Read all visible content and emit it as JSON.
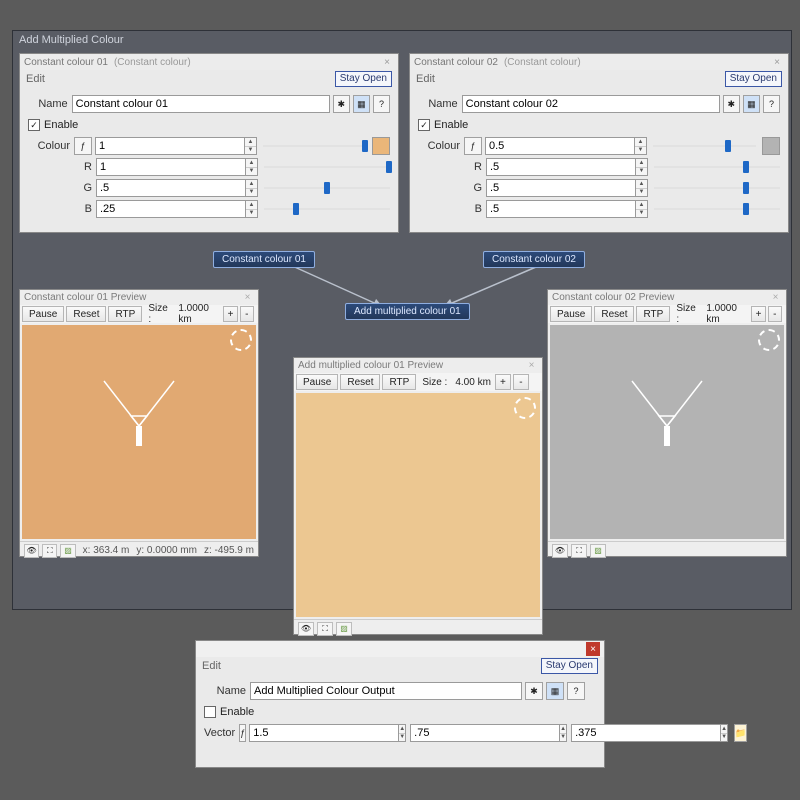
{
  "mainTitle": "Add Multiplied Colour",
  "stayOpen": "Stay Open",
  "editLabel": "Edit",
  "nameLabel": "Name",
  "enableLabel": "Enable",
  "colourLabel": "Colour",
  "vectorLabel": "Vector",
  "panels": {
    "c1": {
      "title": "Constant colour 01",
      "type": "(Constant colour)",
      "name": "Constant colour 01",
      "enabled": true,
      "channels": {
        "master": {
          "label": "",
          "value": "1",
          "pos": 0.99
        },
        "r": {
          "label": "R",
          "value": "1",
          "pos": 0.99
        },
        "g": {
          "label": "G",
          "value": ".5",
          "pos": 0.5
        },
        "b": {
          "label": "B",
          "value": ".25",
          "pos": 0.25
        }
      },
      "swatch": "#eab679"
    },
    "c2": {
      "title": "Constant colour 02",
      "type": "(Constant colour)",
      "name": "Constant colour 02",
      "enabled": true,
      "channels": {
        "master": {
          "label": "",
          "value": "0.5",
          "pos": 0.73
        },
        "r": {
          "label": "R",
          "value": ".5",
          "pos": 0.73
        },
        "g": {
          "label": "G",
          "value": ".5",
          "pos": 0.73
        },
        "b": {
          "label": "B",
          "value": ".5",
          "pos": 0.73
        }
      },
      "swatch": "#b3b3b3"
    }
  },
  "nodes": {
    "n1": "Constant colour 01",
    "n2": "Constant colour 02",
    "n3": "Add multiplied colour 01"
  },
  "previews": {
    "p1": {
      "title": "Constant colour 01 Preview",
      "pause": "Pause",
      "reset": "Reset",
      "rtp": "RTP",
      "sizeLabel": "Size :",
      "size": "1.0000 km",
      "bg": "#e1a972",
      "coords": {
        "x": "x: 363.4 m",
        "y": "y: 0.0000 mm",
        "z": "z: -495.9 m"
      }
    },
    "p2": {
      "title": "Constant colour 02 Preview",
      "pause": "Pause",
      "reset": "Reset",
      "rtp": "RTP",
      "sizeLabel": "Size :",
      "size": "1.0000 km",
      "bg": "#b3b3b3"
    },
    "p3": {
      "title": "Add multiplied colour 01 Preview",
      "pause": "Pause",
      "reset": "Reset",
      "rtp": "RTP",
      "sizeLabel": "Size :",
      "size": "4.00 km",
      "bg": "#ecc791"
    }
  },
  "output": {
    "name": "Add Multiplied Colour Output",
    "enabled": false,
    "vector": {
      "x": "1.5",
      "y": ".75",
      "z": ".375"
    }
  }
}
